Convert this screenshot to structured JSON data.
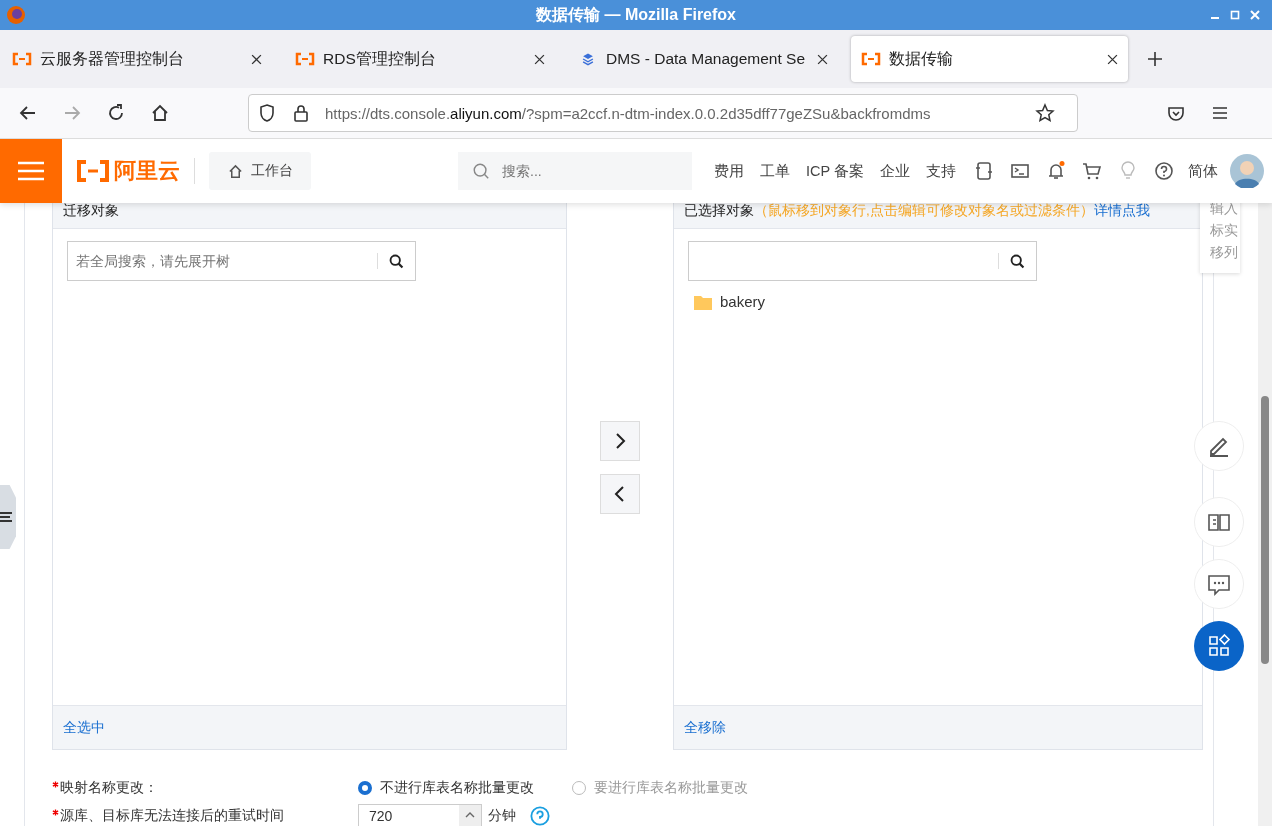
{
  "window": {
    "title": "数据传输 — Mozilla Firefox"
  },
  "tabs": [
    {
      "label": "云服务器管理控制台",
      "selected": false
    },
    {
      "label": "RDS管理控制台",
      "selected": false
    },
    {
      "label": "DMS - Data Management Se",
      "selected": false
    },
    {
      "label": "数据传输",
      "selected": true
    }
  ],
  "url": {
    "prefix": "https://dts.console.",
    "domain": "aliyun.com",
    "suffix": "/?spm=a2ccf.n-dtm-index.0.0.2d35dff77geZSu&backfromdms"
  },
  "header": {
    "logo": "阿里云",
    "workbench": "工作台",
    "search_placeholder": "搜索...",
    "links": [
      "费用",
      "工单",
      "ICP 备案",
      "企业",
      "支持"
    ],
    "notification_dot": true,
    "language": "简体"
  },
  "source_panel": {
    "title": "迁移对象",
    "search_placeholder": "若全局搜索，请先展开树",
    "footer_link": "全选中"
  },
  "target_panel": {
    "title": "已选择对象",
    "hint": "（鼠标移到对象行,点击编辑可修改对象名或过滤条件）",
    "hint_link": "详情点我",
    "items": [
      {
        "label": "bakery"
      }
    ],
    "footer_link": "全移除"
  },
  "side_tip": [
    "辑入",
    "标实",
    "移列"
  ],
  "form": {
    "rows": [
      {
        "label": "映射名称更改：",
        "required": true,
        "kind": "radio",
        "options": [
          {
            "label": "不进行库表名称批量更改",
            "selected": true
          },
          {
            "label": "要进行库表名称批量更改",
            "selected": false
          }
        ]
      },
      {
        "label": "源库、目标库无法连接后的重试时间",
        "required": true,
        "kind": "number",
        "value": "720",
        "unit": "分钟"
      }
    ]
  }
}
